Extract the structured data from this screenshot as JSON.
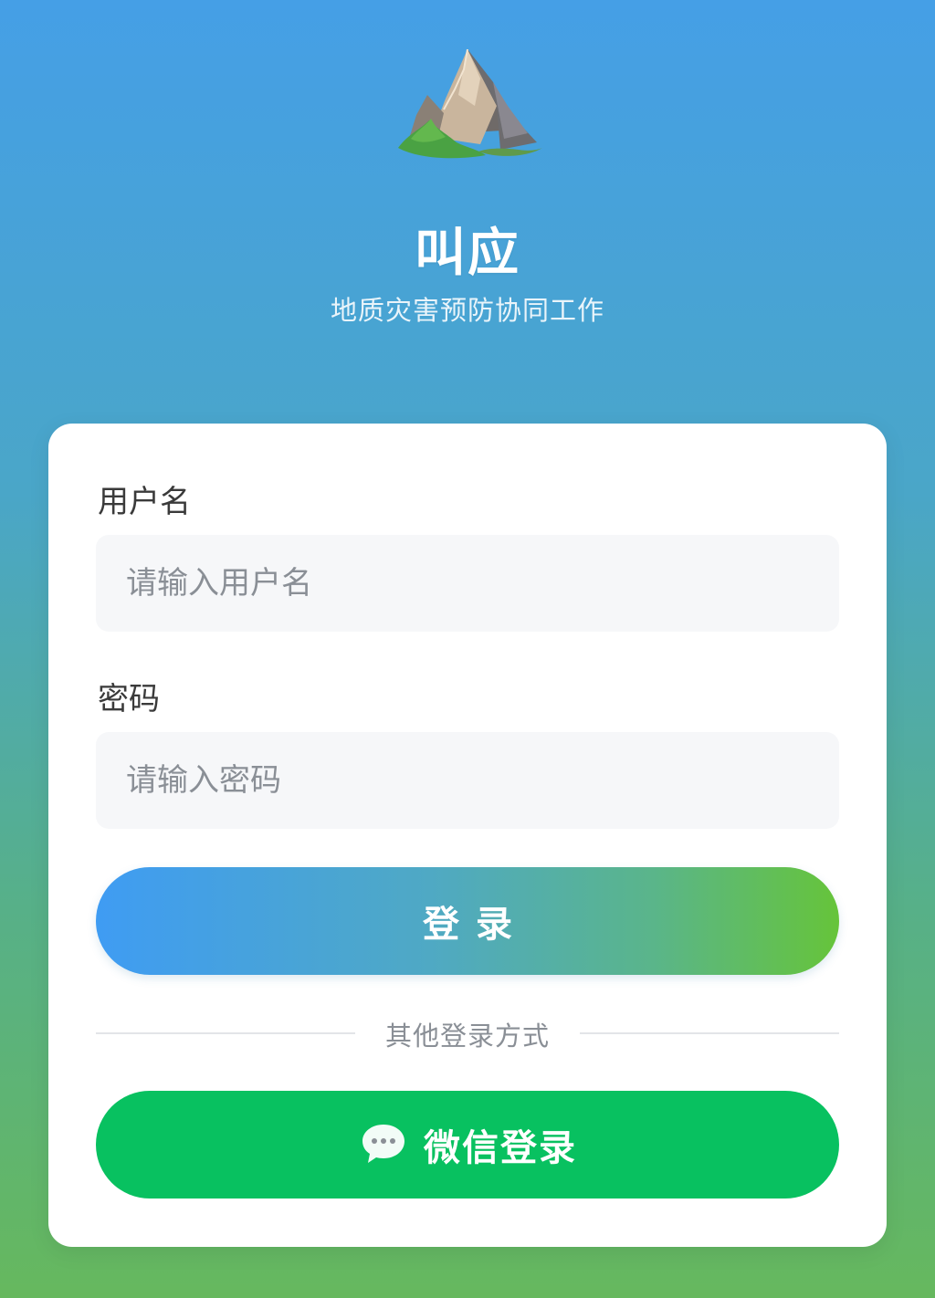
{
  "header": {
    "logo_icon": "mountain-icon",
    "title": "叫应",
    "subtitle": "地质灾害预防协同工作"
  },
  "form": {
    "username_label": "用户名",
    "username_placeholder": "请输入用户名",
    "username_value": "",
    "password_label": "密码",
    "password_placeholder": "请输入密码",
    "password_value": "",
    "login_label": "登录"
  },
  "other_login": {
    "divider_text": "其他登录方式",
    "wechat_icon": "wechat-chat-bubble-icon",
    "wechat_label": "微信登录"
  },
  "colors": {
    "wechat_green": "#08c160",
    "login_gradient_start": "#3f9cf3",
    "login_gradient_end": "#66c43a",
    "background_top": "#459fe6",
    "background_bottom": "#66b85e"
  }
}
